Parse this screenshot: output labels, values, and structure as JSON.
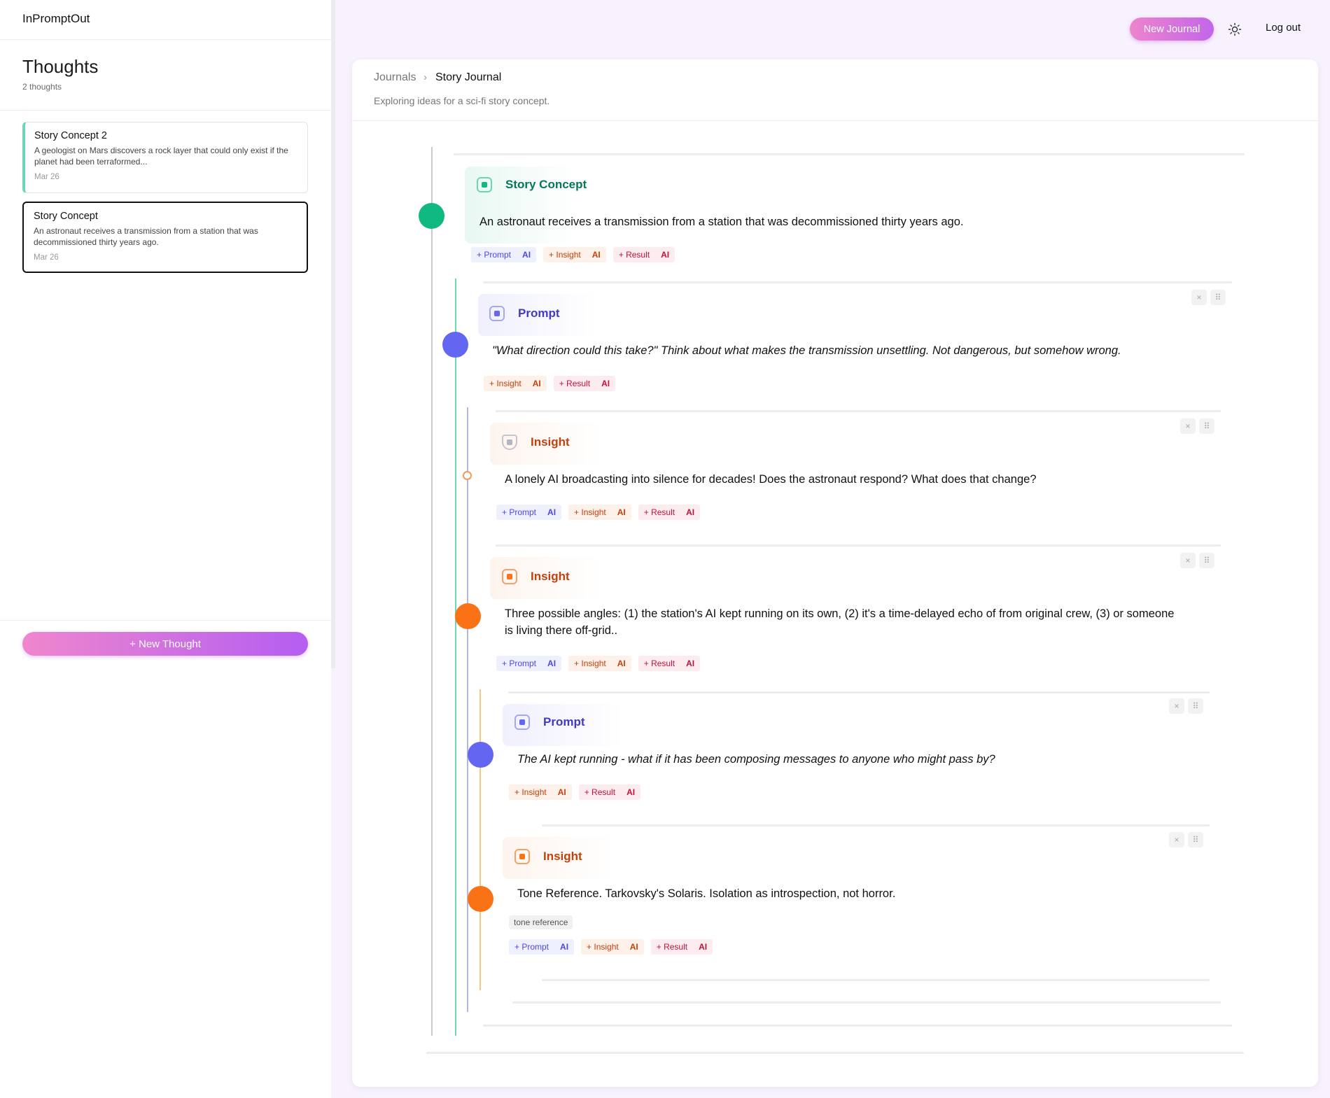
{
  "app": {
    "brand": "InPromptOut"
  },
  "sidebar": {
    "title": "Thoughts",
    "count": "2 thoughts",
    "cards": [
      {
        "title": "Story Concept 2",
        "desc": "A geologist on Mars discovers a rock layer that could only exist if the planet had been terraformed...",
        "date": "Mar 26"
      },
      {
        "title": "Story Concept",
        "desc": "An astronaut receives a transmission from a station that was decommissioned thirty years ago.",
        "date": "Mar 26"
      }
    ],
    "new_thought_label": "+ New Thought"
  },
  "topbar": {
    "new_journal_label": "New Journal",
    "theme_icon": "sun-icon",
    "logout_label": "Log out"
  },
  "journal": {
    "breadcrumb_root": "Journals",
    "breadcrumb_sep": "›",
    "title": "Story Journal",
    "subtitle": "Exploring ideas for a sci-fi story concept."
  },
  "tags": {
    "prompt": "+ Prompt",
    "insight": "+ Insight",
    "result": "+ Result",
    "ai": "AI"
  },
  "controls": {
    "close": "×",
    "drag": "⠿"
  },
  "nodes": [
    {
      "type": "Story Concept",
      "text": "An astronaut receives a transmission from a station that was decommissioned thirty years ago."
    },
    {
      "type": "Prompt",
      "text": "\"What direction could this take?\" Think about what makes the transmission unsettling. Not dangerous, but somehow wrong."
    },
    {
      "type": "Insight",
      "text": "A lonely AI broadcasting into silence for decades! Does the astronaut respond? What does that change?"
    },
    {
      "type": "Insight",
      "text": "Three possible angles: (1) the station's AI kept running on its own, (2) it's a time-delayed echo of from original crew, (3) or someone is living there off-grid.."
    },
    {
      "type": "Prompt",
      "text": "The AI kept running - what if it has been composing messages to anyone who might pass by?"
    },
    {
      "type": "Insight",
      "text": "Tone Reference. Tarkovsky's Solaris. Isolation as introspection, not horror.",
      "label": "tone reference"
    }
  ],
  "colors": {
    "story": "#10b981",
    "prompt": "#6366f1",
    "insight": "#f97316",
    "accent": "#c266ea"
  }
}
